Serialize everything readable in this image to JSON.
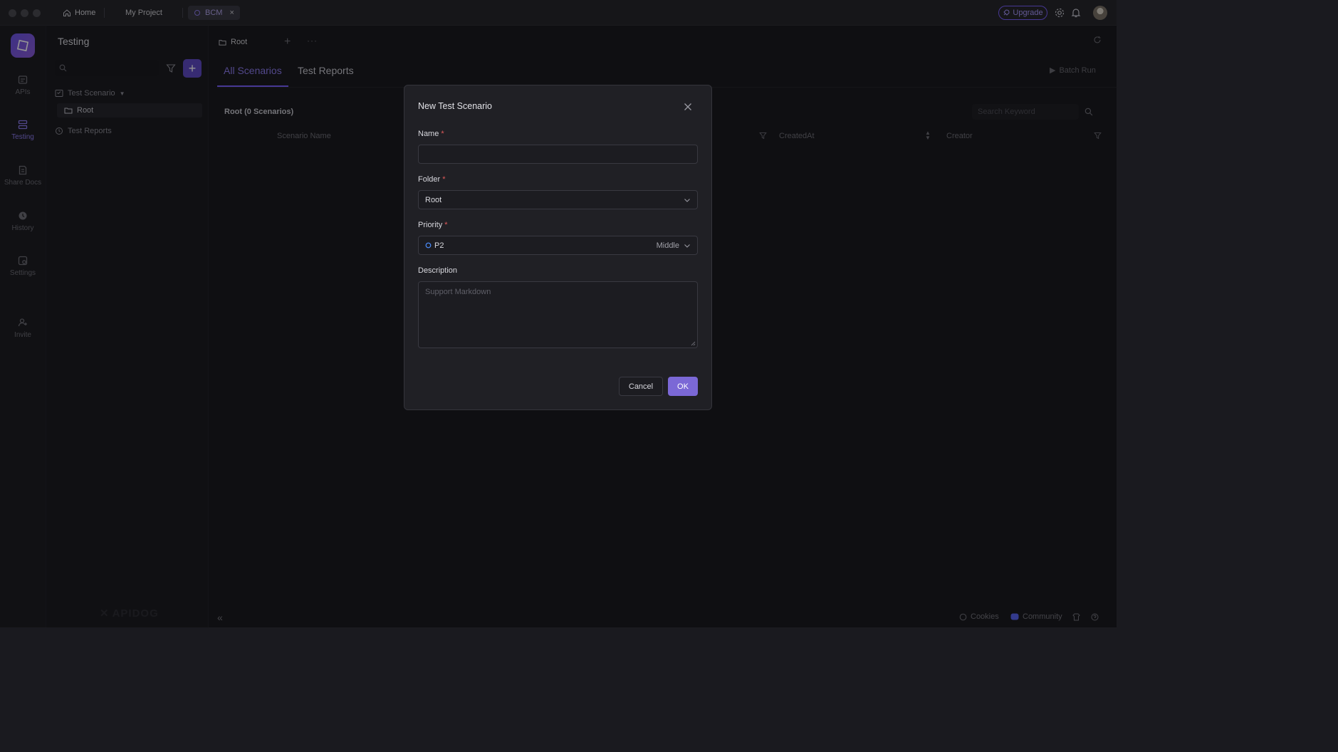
{
  "window": {
    "tabs": [
      {
        "label": "Home"
      },
      {
        "label": "My Project"
      },
      {
        "label": "BCM"
      }
    ],
    "upgrade_label": "Upgrade"
  },
  "leftnav": {
    "items": [
      {
        "label": "APIs"
      },
      {
        "label": "Testing"
      },
      {
        "label": "Share Docs"
      },
      {
        "label": "History"
      },
      {
        "label": "Settings"
      },
      {
        "label": "Invite"
      }
    ]
  },
  "tree": {
    "title": "Testing",
    "search_placeholder": "",
    "scenario_group": "Test Scenario",
    "root_folder": "Root",
    "reports": "Test Reports",
    "watermark": "APIDOG"
  },
  "main": {
    "breadcrumb": "Root",
    "tabs": [
      {
        "label": "All Scenarios"
      },
      {
        "label": "Test Reports"
      }
    ],
    "batch_run": "Batch Run",
    "root_count": "Root (0 Scenarios)",
    "search_placeholder": "Search Keyword",
    "columns": [
      "Scenario Name",
      "CreatedAt",
      "Creator"
    ]
  },
  "modal": {
    "title": "New Test Scenario",
    "name_label": "Name",
    "name_value": "",
    "folder_label": "Folder",
    "folder_value": "Root",
    "priority_label": "Priority",
    "priority_value": "P2",
    "priority_level": "Middle",
    "description_label": "Description",
    "description_placeholder": "Support Markdown",
    "cancel_label": "Cancel",
    "ok_label": "OK",
    "required_mark": "*"
  },
  "footer": {
    "cookies": "Cookies",
    "community": "Community"
  },
  "colors": {
    "accent": "#7b61ff",
    "background": "#1a1a1f"
  }
}
